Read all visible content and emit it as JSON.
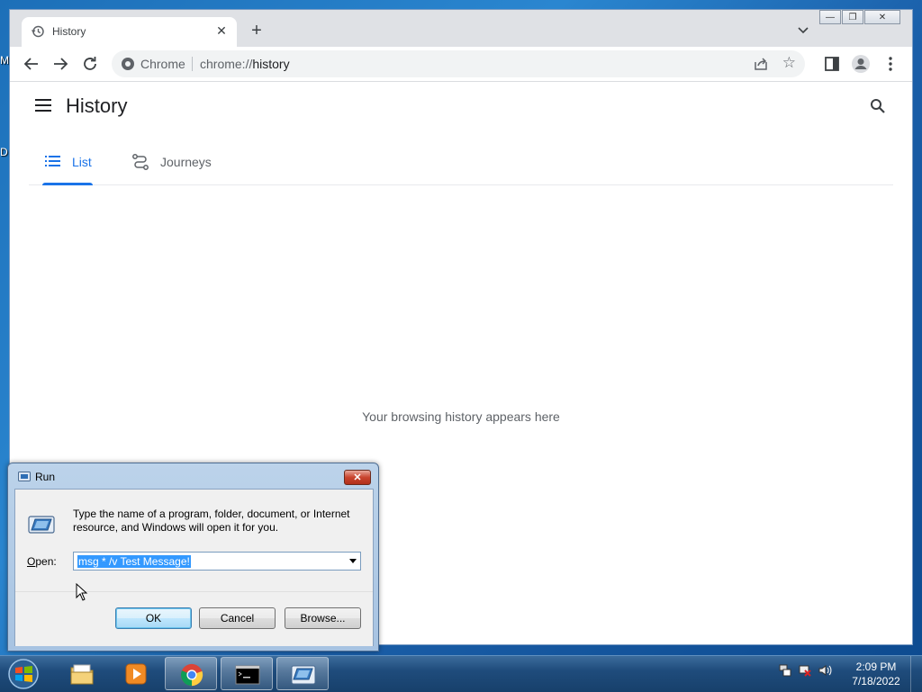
{
  "desktop": {
    "edge_label_1": "M",
    "edge_label_2": "D"
  },
  "browser": {
    "tab": {
      "title": "History"
    },
    "omnibox": {
      "site_name": "Chrome",
      "url_scheme": "chrome://",
      "url_path": "history"
    }
  },
  "history_page": {
    "title": "History",
    "tabs": [
      {
        "label": "List",
        "active": true
      },
      {
        "label": "Journeys",
        "active": false
      }
    ],
    "empty_message": "Your browsing history appears here"
  },
  "run_dialog": {
    "title": "Run",
    "description": "Type the name of a program, folder, document, or Internet resource, and Windows will open it for you.",
    "open_label_accel": "O",
    "open_label_rest": "pen:",
    "open_value": "msg * /v Test Message!",
    "buttons": {
      "ok": "OK",
      "cancel": "Cancel",
      "browse": "Browse..."
    }
  },
  "taskbar": {
    "items": [
      "file-explorer",
      "media-player",
      "chrome",
      "command-prompt",
      "run"
    ],
    "clock": {
      "time": "2:09 PM",
      "date": "7/18/2022"
    }
  }
}
